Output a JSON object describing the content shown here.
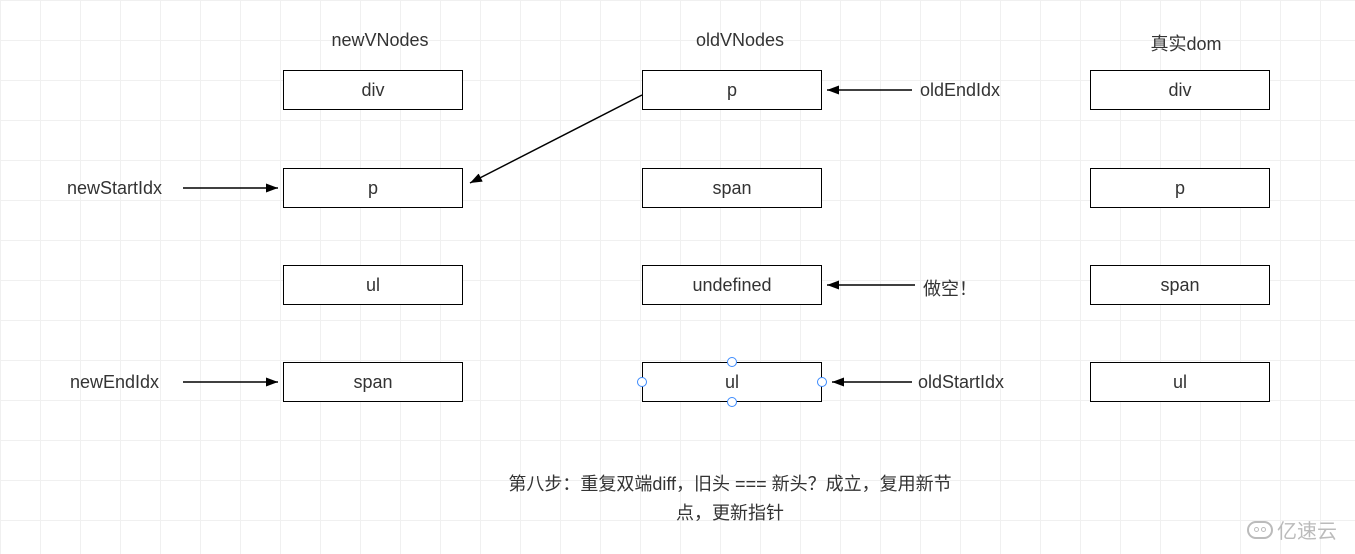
{
  "columns": {
    "new": {
      "title": "newVNodes",
      "items": [
        "div",
        "p",
        "ul",
        "span"
      ]
    },
    "old": {
      "title": "oldVNodes",
      "items": [
        "p",
        "span",
        "undefined",
        "ul"
      ]
    },
    "real": {
      "title": "真实dom",
      "items": [
        "div",
        "p",
        "span",
        "ul"
      ]
    }
  },
  "pointers": {
    "newStartIdx": "newStartIdx",
    "newEndIdx": "newEndIdx",
    "oldEndIdx": "oldEndIdx",
    "oldStartIdx": "oldStartIdx",
    "makeEmpty": "做空！"
  },
  "caption": {
    "line1": "第八步：重复双端diff，旧头 === 新头？成立，复用新节",
    "line2": "点，更新指针"
  },
  "logo": "亿速云"
}
